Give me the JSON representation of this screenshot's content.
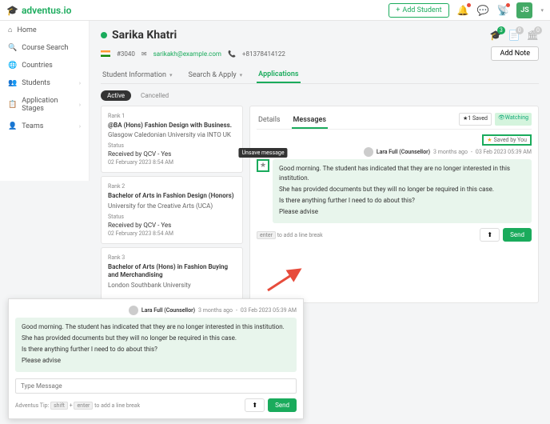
{
  "brand": "adventus.io",
  "topbar": {
    "add_student": "Add Student",
    "avatar": "JS"
  },
  "sidebar": {
    "items": [
      {
        "label": "Home"
      },
      {
        "label": "Course Search"
      },
      {
        "label": "Countries"
      },
      {
        "label": "Students"
      },
      {
        "label": "Application Stages"
      },
      {
        "label": "Teams"
      }
    ]
  },
  "student": {
    "name": "Sarika Khatri",
    "id": "#3040",
    "email": "sarikakh@example.com",
    "phone": "+81378414122",
    "header_badge": "3",
    "counts": {
      "a": "0",
      "b": "0"
    }
  },
  "buttons": {
    "add_note": "Add Note",
    "send": "Send"
  },
  "tabs": {
    "t1": "Student Information",
    "t2": "Search & Apply",
    "t3": "Applications"
  },
  "pills": {
    "active": "Active",
    "cancelled": "Cancelled"
  },
  "apps": [
    {
      "rank": "Rank 1",
      "title": "@BA (Hons) Fashion Design with Business.",
      "uni": "Glasgow Caledonian University via INTO UK",
      "status_lbl": "Status",
      "status": "Received by QCV - Yes",
      "date": "02 February 2023 8:54 AM"
    },
    {
      "rank": "Rank 2",
      "title": "Bachelor of Arts in Fashion Design (Honors)",
      "uni": "University for the Creative Arts (UCA)",
      "status_lbl": "Status",
      "status": "Received by QCV - Yes",
      "date": "02 February 2023 8:54 AM"
    },
    {
      "rank": "Rank 3",
      "title": "Bachelor of Arts (Hons) in Fashion Buying and Merchandising",
      "uni": "London Southbank University",
      "status_lbl": "",
      "status": "",
      "date": ""
    }
  ],
  "subtabs": {
    "details": "Details",
    "messages": "Messages"
  },
  "saved": {
    "count": "1 Saved",
    "watching": "Watching",
    "by_you": "Saved by You"
  },
  "message": {
    "author": "Lara Full (Counsellor)",
    "ago": "3 months ago",
    "timestamp": "03 Feb 2023 05:39 AM",
    "tooltip": "Unsave message",
    "lines": [
      "Good morning. The student has indicated that they are no longer interested in this institution.",
      "She has provided documents but they will no longer be required in this case.",
      "Is there anything further I need to do about this?",
      "Please advise"
    ]
  },
  "input": {
    "placeholder": "Type Message",
    "tip_prefix": "Adventus Tip:",
    "tip_suffix": "to add a line break",
    "shift": "shift",
    "enter": "enter",
    "plus": "+"
  }
}
